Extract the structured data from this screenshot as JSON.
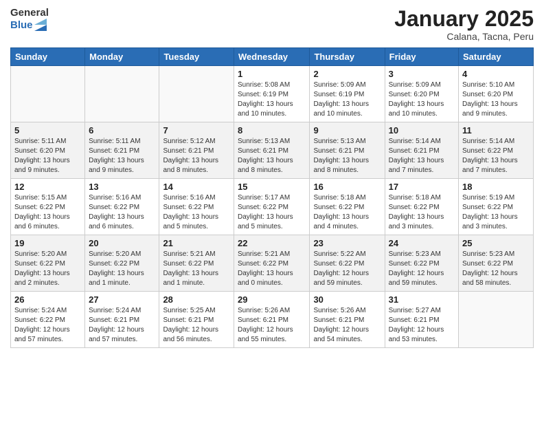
{
  "header": {
    "logo_general": "General",
    "logo_blue": "Blue",
    "month_title": "January 2025",
    "subtitle": "Calana, Tacna, Peru"
  },
  "weekdays": [
    "Sunday",
    "Monday",
    "Tuesday",
    "Wednesday",
    "Thursday",
    "Friday",
    "Saturday"
  ],
  "weeks": [
    [
      {
        "day": "",
        "info": ""
      },
      {
        "day": "",
        "info": ""
      },
      {
        "day": "",
        "info": ""
      },
      {
        "day": "1",
        "info": "Sunrise: 5:08 AM\nSunset: 6:19 PM\nDaylight: 13 hours\nand 10 minutes."
      },
      {
        "day": "2",
        "info": "Sunrise: 5:09 AM\nSunset: 6:19 PM\nDaylight: 13 hours\nand 10 minutes."
      },
      {
        "day": "3",
        "info": "Sunrise: 5:09 AM\nSunset: 6:20 PM\nDaylight: 13 hours\nand 10 minutes."
      },
      {
        "day": "4",
        "info": "Sunrise: 5:10 AM\nSunset: 6:20 PM\nDaylight: 13 hours\nand 9 minutes."
      }
    ],
    [
      {
        "day": "5",
        "info": "Sunrise: 5:11 AM\nSunset: 6:20 PM\nDaylight: 13 hours\nand 9 minutes."
      },
      {
        "day": "6",
        "info": "Sunrise: 5:11 AM\nSunset: 6:21 PM\nDaylight: 13 hours\nand 9 minutes."
      },
      {
        "day": "7",
        "info": "Sunrise: 5:12 AM\nSunset: 6:21 PM\nDaylight: 13 hours\nand 8 minutes."
      },
      {
        "day": "8",
        "info": "Sunrise: 5:13 AM\nSunset: 6:21 PM\nDaylight: 13 hours\nand 8 minutes."
      },
      {
        "day": "9",
        "info": "Sunrise: 5:13 AM\nSunset: 6:21 PM\nDaylight: 13 hours\nand 8 minutes."
      },
      {
        "day": "10",
        "info": "Sunrise: 5:14 AM\nSunset: 6:21 PM\nDaylight: 13 hours\nand 7 minutes."
      },
      {
        "day": "11",
        "info": "Sunrise: 5:14 AM\nSunset: 6:22 PM\nDaylight: 13 hours\nand 7 minutes."
      }
    ],
    [
      {
        "day": "12",
        "info": "Sunrise: 5:15 AM\nSunset: 6:22 PM\nDaylight: 13 hours\nand 6 minutes."
      },
      {
        "day": "13",
        "info": "Sunrise: 5:16 AM\nSunset: 6:22 PM\nDaylight: 13 hours\nand 6 minutes."
      },
      {
        "day": "14",
        "info": "Sunrise: 5:16 AM\nSunset: 6:22 PM\nDaylight: 13 hours\nand 5 minutes."
      },
      {
        "day": "15",
        "info": "Sunrise: 5:17 AM\nSunset: 6:22 PM\nDaylight: 13 hours\nand 5 minutes."
      },
      {
        "day": "16",
        "info": "Sunrise: 5:18 AM\nSunset: 6:22 PM\nDaylight: 13 hours\nand 4 minutes."
      },
      {
        "day": "17",
        "info": "Sunrise: 5:18 AM\nSunset: 6:22 PM\nDaylight: 13 hours\nand 3 minutes."
      },
      {
        "day": "18",
        "info": "Sunrise: 5:19 AM\nSunset: 6:22 PM\nDaylight: 13 hours\nand 3 minutes."
      }
    ],
    [
      {
        "day": "19",
        "info": "Sunrise: 5:20 AM\nSunset: 6:22 PM\nDaylight: 13 hours\nand 2 minutes."
      },
      {
        "day": "20",
        "info": "Sunrise: 5:20 AM\nSunset: 6:22 PM\nDaylight: 13 hours\nand 1 minute."
      },
      {
        "day": "21",
        "info": "Sunrise: 5:21 AM\nSunset: 6:22 PM\nDaylight: 13 hours\nand 1 minute."
      },
      {
        "day": "22",
        "info": "Sunrise: 5:21 AM\nSunset: 6:22 PM\nDaylight: 13 hours\nand 0 minutes."
      },
      {
        "day": "23",
        "info": "Sunrise: 5:22 AM\nSunset: 6:22 PM\nDaylight: 12 hours\nand 59 minutes."
      },
      {
        "day": "24",
        "info": "Sunrise: 5:23 AM\nSunset: 6:22 PM\nDaylight: 12 hours\nand 59 minutes."
      },
      {
        "day": "25",
        "info": "Sunrise: 5:23 AM\nSunset: 6:22 PM\nDaylight: 12 hours\nand 58 minutes."
      }
    ],
    [
      {
        "day": "26",
        "info": "Sunrise: 5:24 AM\nSunset: 6:22 PM\nDaylight: 12 hours\nand 57 minutes."
      },
      {
        "day": "27",
        "info": "Sunrise: 5:24 AM\nSunset: 6:21 PM\nDaylight: 12 hours\nand 57 minutes."
      },
      {
        "day": "28",
        "info": "Sunrise: 5:25 AM\nSunset: 6:21 PM\nDaylight: 12 hours\nand 56 minutes."
      },
      {
        "day": "29",
        "info": "Sunrise: 5:26 AM\nSunset: 6:21 PM\nDaylight: 12 hours\nand 55 minutes."
      },
      {
        "day": "30",
        "info": "Sunrise: 5:26 AM\nSunset: 6:21 PM\nDaylight: 12 hours\nand 54 minutes."
      },
      {
        "day": "31",
        "info": "Sunrise: 5:27 AM\nSunset: 6:21 PM\nDaylight: 12 hours\nand 53 minutes."
      },
      {
        "day": "",
        "info": ""
      }
    ]
  ]
}
